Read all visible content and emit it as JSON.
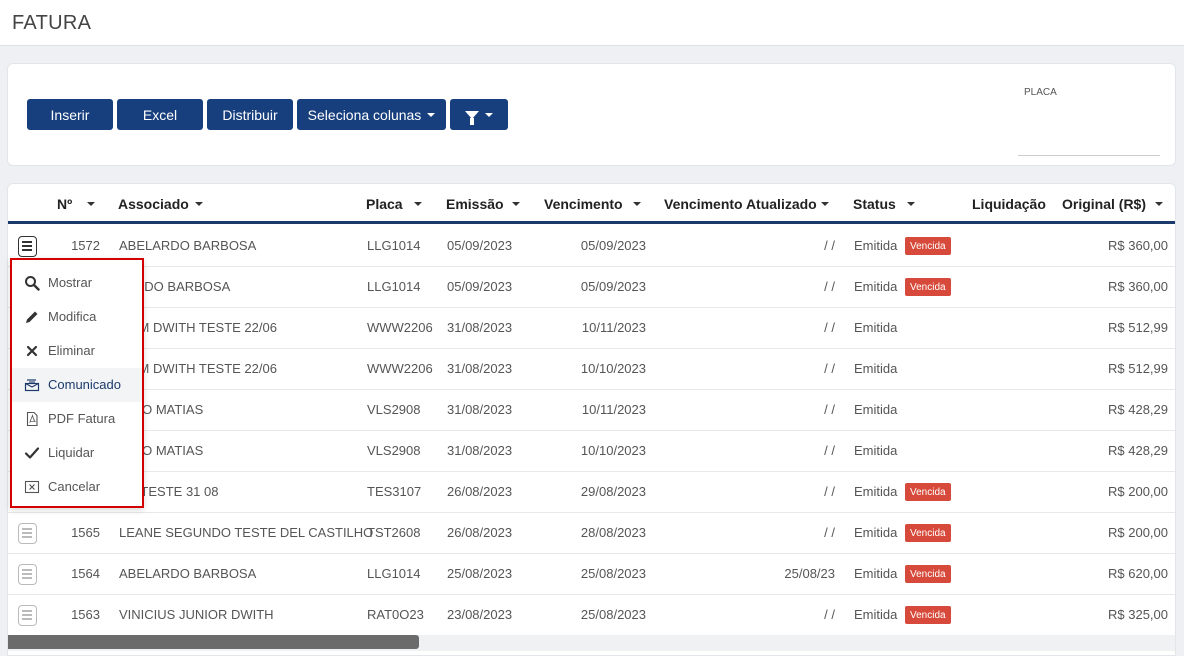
{
  "page": {
    "title": "FATURA"
  },
  "toolbar": {
    "insert_label": "Inserir",
    "excel_label": "Excel",
    "distribute_label": "Distribuir",
    "columns_label": "Seleciona colunas",
    "placa_label": "PLACA",
    "placa_value": ""
  },
  "table": {
    "headers": {
      "numero": "Nº",
      "associado": "Associado",
      "placa": "Placa",
      "emissao": "Emissão",
      "vencimento": "Vencimento",
      "vencimento_atualizado": "Vencimento Atualizado",
      "status": "Status",
      "liquidacao": "Liquidação",
      "original": "Original (R$)"
    },
    "rows": [
      {
        "numero": "1572",
        "associado": "ABELARDO BARBOSA",
        "placa": "LLG1014",
        "emissao": "05/09/2023",
        "vencimento": "05/09/2023",
        "vencimento_atualizado": "/ /",
        "status": "Emitida",
        "badge": "Vencida",
        "liquidacao": "",
        "original": "R$ 360,00"
      },
      {
        "numero": "",
        "associado": "LARDO BARBOSA",
        "placa": "LLG1014",
        "emissao": "05/09/2023",
        "vencimento": "05/09/2023",
        "vencimento_atualizado": "/ /",
        "status": "Emitida",
        "badge": "Vencida",
        "liquidacao": "",
        "original": "R$ 360,00"
      },
      {
        "numero": "",
        "associado": "LIAM DWITH TESTE 22/06",
        "placa": "WWW2206",
        "emissao": "31/08/2023",
        "vencimento": "10/11/2023",
        "vencimento_atualizado": "/ /",
        "status": "Emitida",
        "badge": "",
        "liquidacao": "",
        "original": "R$ 512,99"
      },
      {
        "numero": "",
        "associado": "LIAM DWITH TESTE 22/06",
        "placa": "WWW2206",
        "emissao": "31/08/2023",
        "vencimento": "10/10/2023",
        "vencimento_atualizado": "/ /",
        "status": "Emitida",
        "badge": "",
        "liquidacao": "",
        "original": "R$ 512,99"
      },
      {
        "numero": "",
        "associado": "ONIO MATIAS",
        "placa": "VLS2908",
        "emissao": "31/08/2023",
        "vencimento": "10/11/2023",
        "vencimento_atualizado": "/ /",
        "status": "Emitida",
        "badge": "",
        "liquidacao": "",
        "original": "R$ 428,29"
      },
      {
        "numero": "",
        "associado": "ONIO MATIAS",
        "placa": "VLS2908",
        "emissao": "31/08/2023",
        "vencimento": "10/10/2023",
        "vencimento_atualizado": "/ /",
        "status": "Emitida",
        "badge": "",
        "liquidacao": "",
        "original": "R$ 428,29"
      },
      {
        "numero": "",
        "associado": "NE TESTE 31 08",
        "placa": "TES3107",
        "emissao": "26/08/2023",
        "vencimento": "29/08/2023",
        "vencimento_atualizado": "/ /",
        "status": "Emitida",
        "badge": "Vencida",
        "liquidacao": "",
        "original": "R$ 200,00"
      },
      {
        "numero": "1565",
        "associado": "LEANE SEGUNDO TESTE DEL CASTILHO",
        "placa": "TST2608",
        "emissao": "26/08/2023",
        "vencimento": "28/08/2023",
        "vencimento_atualizado": "/ /",
        "status": "Emitida",
        "badge": "Vencida",
        "liquidacao": "",
        "original": "R$ 200,00"
      },
      {
        "numero": "1564",
        "associado": "ABELARDO BARBOSA",
        "placa": "LLG1014",
        "emissao": "25/08/2023",
        "vencimento": "25/08/2023",
        "vencimento_atualizado": "25/08/23",
        "status": "Emitida",
        "badge": "Vencida",
        "liquidacao": "",
        "original": "R$ 620,00"
      },
      {
        "numero": "1563",
        "associado": "VINICIUS JUNIOR DWITH",
        "placa": "RAT0O23",
        "emissao": "23/08/2023",
        "vencimento": "25/08/2023",
        "vencimento_atualizado": "/ /",
        "status": "Emitida",
        "badge": "Vencida",
        "liquidacao": "",
        "original": "R$ 325,00"
      }
    ]
  },
  "context_menu": {
    "items": [
      {
        "label": "Mostrar",
        "icon": "search-icon"
      },
      {
        "label": "Modifica",
        "icon": "pencil-icon"
      },
      {
        "label": "Eliminar",
        "icon": "x-icon"
      },
      {
        "label": "Comunicado",
        "icon": "communication-icon"
      },
      {
        "label": "PDF Fatura",
        "icon": "pdf-icon"
      },
      {
        "label": "Liquidar",
        "icon": "check-icon"
      },
      {
        "label": "Cancelar",
        "icon": "cancel-box-icon"
      }
    ]
  },
  "colors": {
    "primary": "#173f7e",
    "badge": "#d74a3b",
    "menu_border": "#d20000"
  }
}
